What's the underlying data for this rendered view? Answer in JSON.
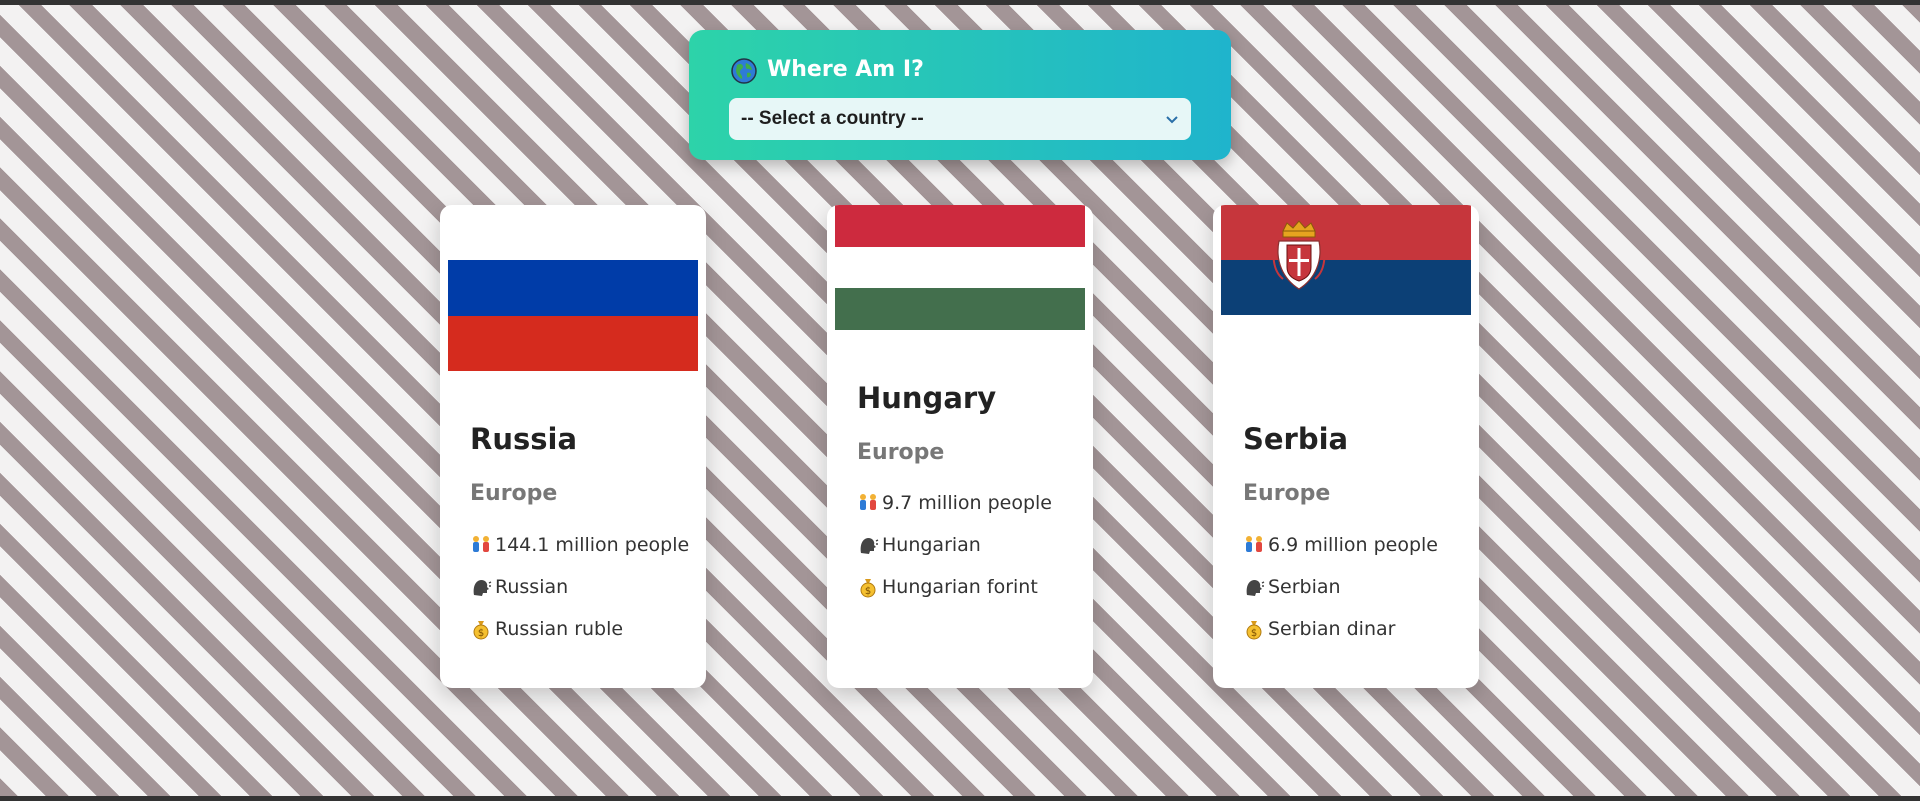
{
  "header": {
    "title": "Where Am I?",
    "icon": "globe-icon"
  },
  "select": {
    "selected_label": "-- Select a country --",
    "icon": "chevron-down-icon"
  },
  "colors": {
    "header_gradient_start": "#2dd3a9",
    "header_gradient_end": "#1fb4cc",
    "stripe_dark": "#a39597",
    "stripe_light": "#f3f2f2"
  },
  "cards": [
    {
      "flag": "russia-flag",
      "name": "Russia",
      "region": "Europe",
      "population": "144.1 million people",
      "language": "Russian",
      "currency": "Russian ruble"
    },
    {
      "flag": "hungary-flag",
      "name": "Hungary",
      "region": "Europe",
      "population": "9.7 million people",
      "language": "Hungarian",
      "currency": "Hungarian forint"
    },
    {
      "flag": "serbia-flag",
      "name": "Serbia",
      "region": "Europe",
      "population": "6.9 million people",
      "language": "Serbian",
      "currency": "Serbian dinar"
    }
  ]
}
